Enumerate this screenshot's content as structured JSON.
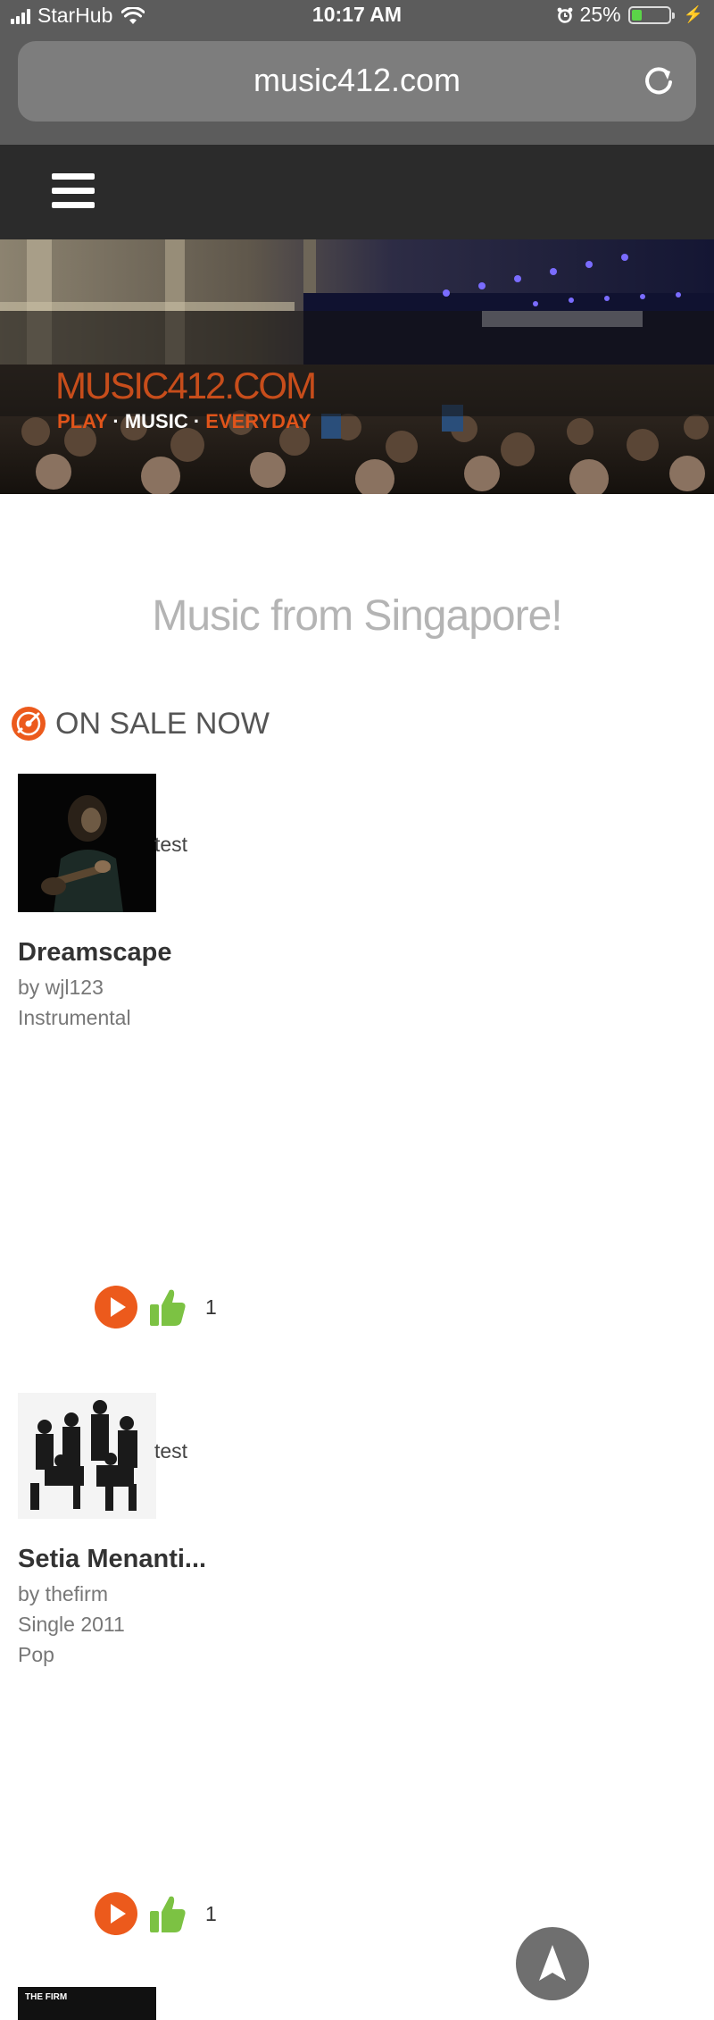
{
  "status_bar": {
    "carrier": "StarHub",
    "time": "10:17 AM",
    "battery_text": "25%",
    "battery_level": 0.25
  },
  "browser": {
    "url": "music412.com"
  },
  "hero": {
    "logo": "MUSIC412.COM",
    "tagline_1": "PLAY",
    "separator": " · ",
    "tagline_2": "MUSIC",
    "tagline_3": "EVERYDAY"
  },
  "main": {
    "heading": "Music from Singapore!",
    "section_title": "ON SALE NOW"
  },
  "products": [
    {
      "caption": "test",
      "title": "Dreamscape",
      "lines": [
        "by wjl123",
        "Instrumental"
      ],
      "likes": "1"
    },
    {
      "caption": "test",
      "title": "Setia Menanti...",
      "lines": [
        "by thefirm",
        "Single 2011",
        "Pop"
      ],
      "likes": "1"
    }
  ],
  "next_product": {
    "thumb_text": "THE FIRM"
  },
  "colors": {
    "accent": "#ec5a1c",
    "like_green": "#7cc243",
    "nav_bg": "#2b2b2b",
    "heading": "#b4b4b4"
  },
  "icons": {
    "menu": "hamburger-icon",
    "reload": "reload-icon",
    "section": "disc-icon",
    "play": "play-icon",
    "like": "thumbs-up-icon",
    "scroll_top": "arrow-up-icon"
  }
}
